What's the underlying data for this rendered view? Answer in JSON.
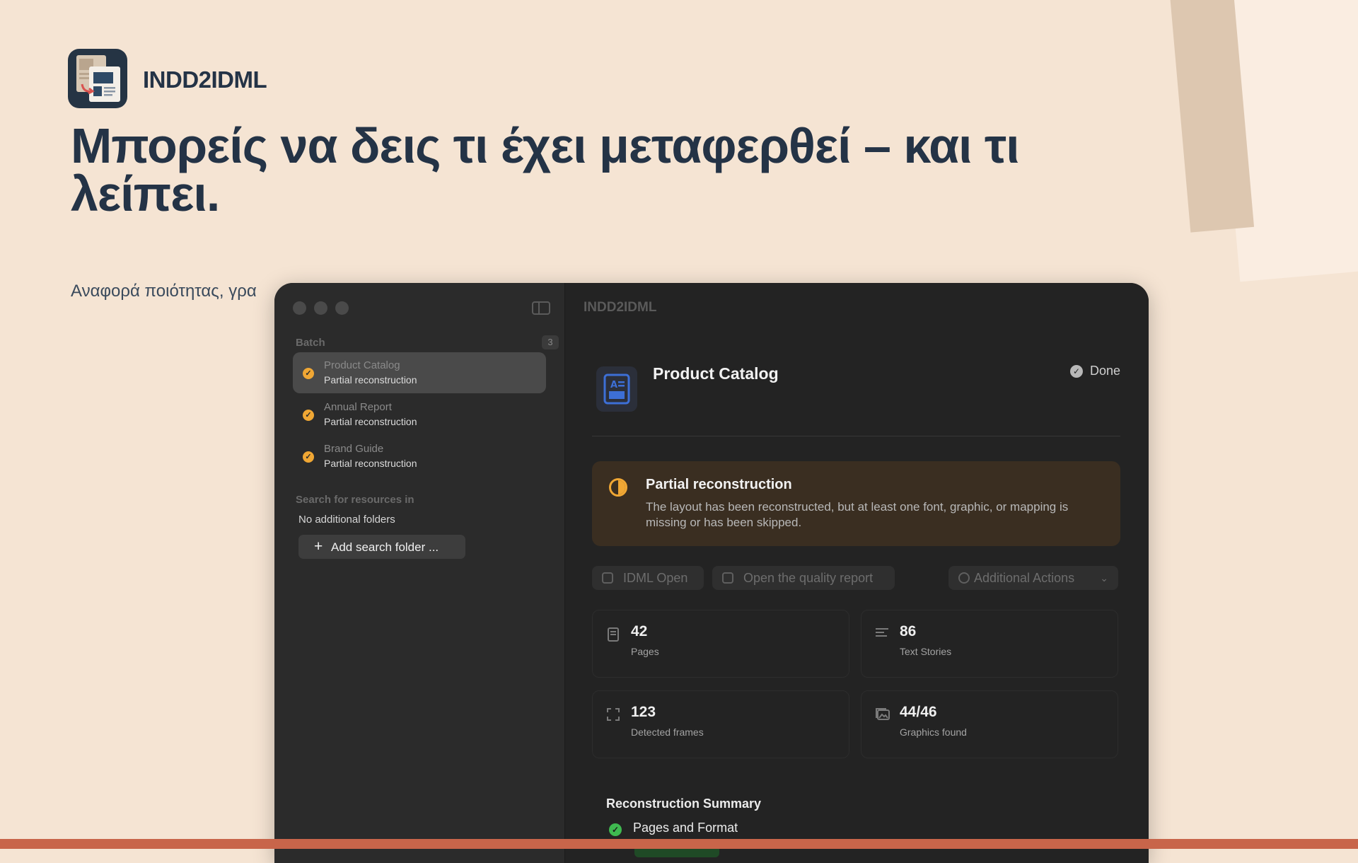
{
  "hero": {
    "app_name": "INDD2IDML",
    "headline": "Μπορείς να δεις τι έχει μεταφερθεί – και τι λείπει.",
    "subline": "Αναφορά ποιότητας, γρα"
  },
  "window": {
    "title": "INDD2IDML",
    "sidebar": {
      "batch_label": "Batch",
      "batch_count": "3",
      "items": [
        {
          "title": "Product Catalog",
          "status": "Partial reconstruction",
          "selected": true
        },
        {
          "title": "Annual Report",
          "status": "Partial reconstruction",
          "selected": false
        },
        {
          "title": "Brand Guide",
          "status": "Partial reconstruction",
          "selected": false
        }
      ],
      "search_label": "Search for resources in",
      "no_folders": "No additional folders",
      "add_folder": "Add search folder ..."
    },
    "toolbar": {
      "icons": [
        "plus-icon",
        "folder-icon",
        "package-icon",
        "arrow-icon",
        "help-icon",
        "info-icon"
      ]
    },
    "document": {
      "title": "Product Catalog",
      "status": "Done"
    },
    "warning": {
      "title": "Partial reconstruction",
      "text": "The layout has been reconstructed, but at least one font, graphic, or mapping is missing or has been skipped."
    },
    "actions": {
      "idml_open": "IDML Open",
      "quality_report": "Open the quality report",
      "additional": "Additional Actions"
    },
    "stats": [
      {
        "value": "42",
        "label": "Pages",
        "icon": "page-icon"
      },
      {
        "value": "86",
        "label": "Text Stories",
        "icon": "text-icon"
      },
      {
        "value": "123",
        "label": "Detected frames",
        "icon": "frame-icon"
      },
      {
        "value": "44/46",
        "label": "Graphics found",
        "icon": "image-icon"
      }
    ],
    "summary": {
      "title": "Reconstruction Summary",
      "items": [
        {
          "label": "Pages and Format",
          "status": "ok"
        }
      ]
    }
  },
  "colors": {
    "background": "#f5e4d3",
    "navy": "#243346",
    "accent_orange": "#f0a734",
    "success_green": "#3fb950",
    "bottom_bar": "#c8654a"
  }
}
